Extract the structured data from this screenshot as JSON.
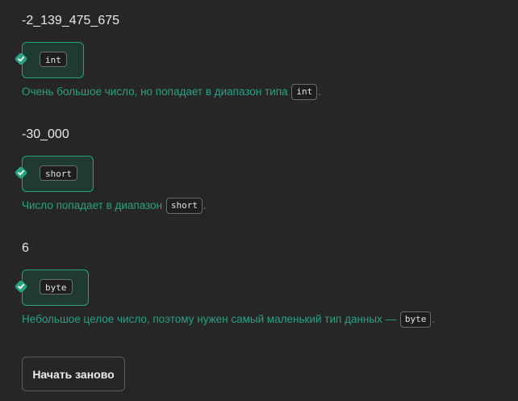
{
  "questions": [
    {
      "value": "-2_139_475_675",
      "answer": "int",
      "explanation_text": "Очень большое число, но попадает в диапазон типа",
      "explanation_code": "int",
      "explanation_after": "."
    },
    {
      "value": "-30_000",
      "answer": "short",
      "explanation_text": "Число попадает в диапазон",
      "explanation_code": "short",
      "explanation_after": "."
    },
    {
      "value": "6",
      "answer": "byte",
      "explanation_text": "Небольшое целое число, поэтому нужен самый маленький тип данных —",
      "explanation_code": "byte",
      "explanation_after": "."
    }
  ],
  "restart_label": "Начать заново",
  "colors": {
    "background": "#262626",
    "correct_accent": "#27a382",
    "text": "#e8e8e8"
  },
  "icons": {
    "correct": "checkmark-icon"
  }
}
